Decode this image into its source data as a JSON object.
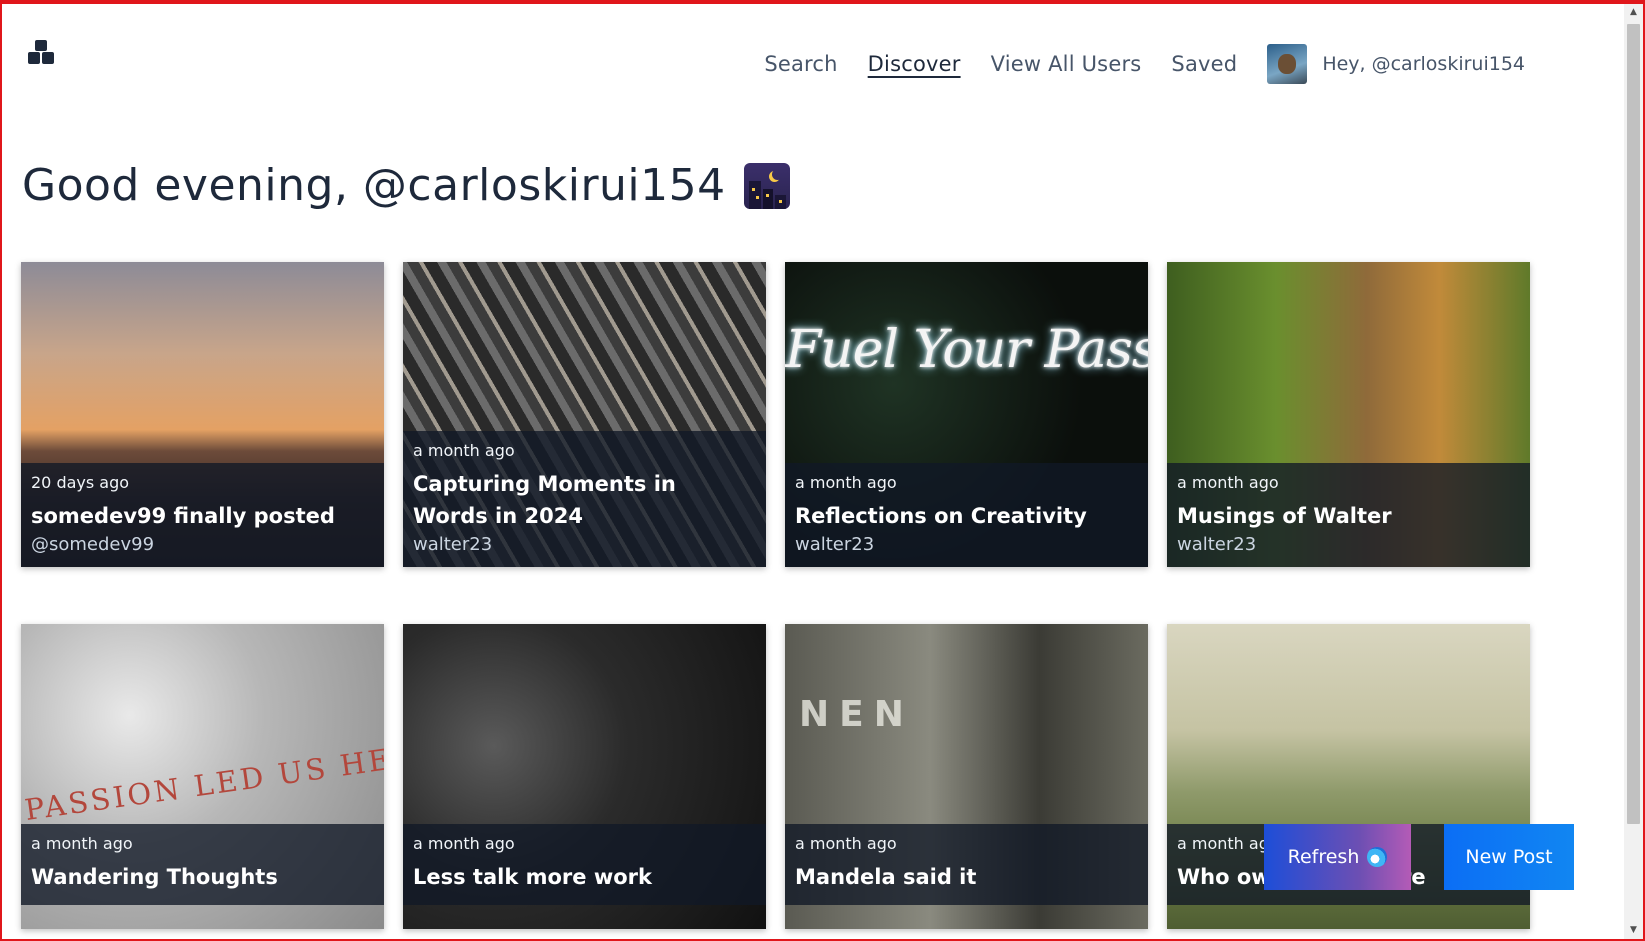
{
  "header": {
    "nav": [
      "Search",
      "Discover",
      "View All Users",
      "Saved"
    ],
    "active": "Discover",
    "user_label": "Hey, @carloskirui154"
  },
  "greeting": "Good evening, @carloskirui154",
  "greeting_icon": "night-city-icon",
  "posts": [
    {
      "time": "20 days ago",
      "title": "somedev99 finally posted",
      "author": "@somedev99"
    },
    {
      "time": "a month ago",
      "title": "Capturing Moments in Words in 2024",
      "author": "walter23"
    },
    {
      "time": "a month ago",
      "title": "Reflections on Creativity",
      "author": "walter23",
      "image_text": "Fuel Your Passion"
    },
    {
      "time": "a month ago",
      "title": "Musings of Walter",
      "author": "walter23"
    },
    {
      "time": "a month ago",
      "title": "Wandering Thoughts",
      "image_text": "PASSION LED US HERE"
    },
    {
      "time": "a month ago",
      "title": "Less talk more work"
    },
    {
      "time": "a month ago",
      "title": "Mandela said it",
      "image_text": "NEN"
    },
    {
      "time": "a month ago",
      "title": "Who owns the future"
    }
  ],
  "actions": {
    "refresh_label": "Refresh",
    "new_post_label": "New Post"
  },
  "colors": {
    "accent_blue": "#0b6ef5",
    "text_dark": "#1e293b",
    "frame_red": "#e0161b"
  }
}
